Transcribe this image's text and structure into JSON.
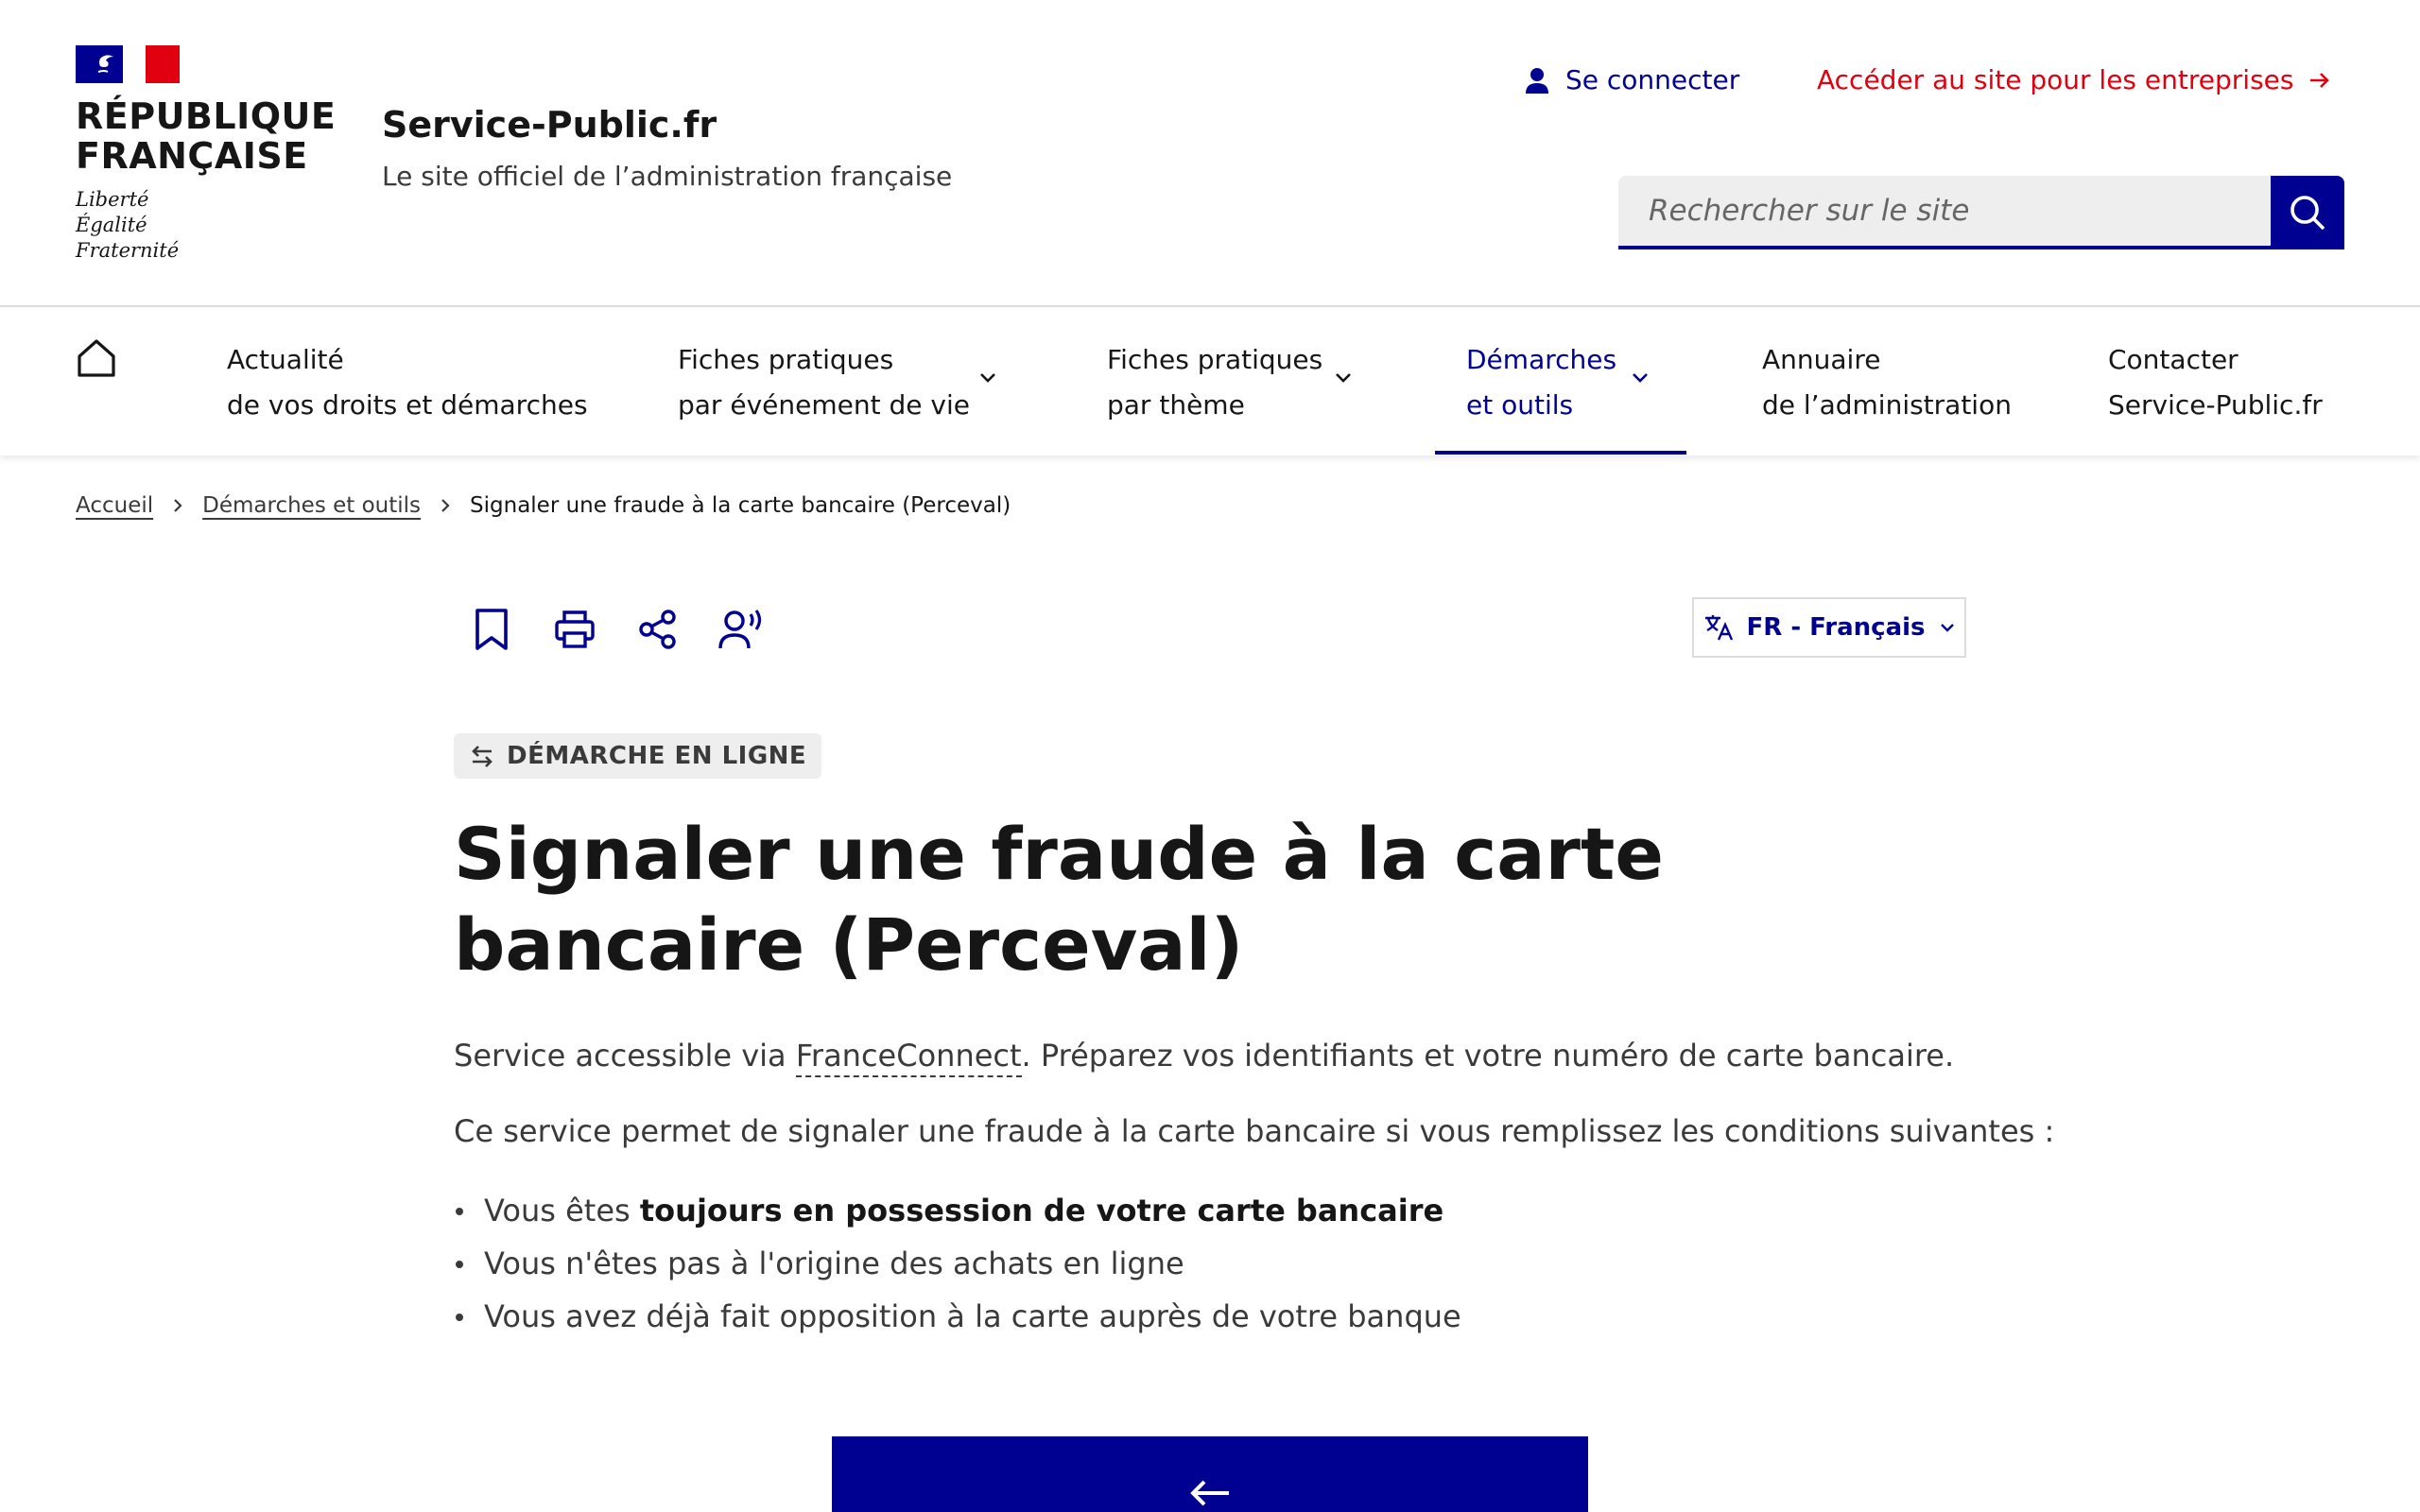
{
  "header": {
    "republic_title_line1": "RÉPUBLIQUE",
    "republic_title_line2": "FRANÇAISE",
    "motto_1": "Liberté",
    "motto_2": "Égalité",
    "motto_3": "Fraternité",
    "service_name": "Service-Public.fr",
    "service_tagline": "Le site officiel de l’administration française",
    "login_label": "Se connecter",
    "pro_link_label": "Accéder au site pour les entreprises",
    "search_placeholder": "Rechercher sur le site",
    "colors": {
      "primary": "#000091",
      "accent_red": "#e1000f"
    }
  },
  "nav": {
    "home_icon": "home-icon",
    "items": [
      {
        "line1": "Actualité",
        "line2": "de vos droits et démarches"
      },
      {
        "line1": "Fiches pratiques",
        "line2": "par événement de vie"
      },
      {
        "line1": "Fiches pratiques",
        "line2": "par thème"
      },
      {
        "line1": "Démarches",
        "line2": "et outils"
      },
      {
        "line1": "Annuaire",
        "line2": "de l’administration"
      },
      {
        "line1": "Contacter",
        "line2": "Service-Public.fr"
      }
    ],
    "active_index": 3
  },
  "breadcrumb": {
    "home": "Accueil",
    "section": "Démarches et outils",
    "current": "Signaler une fraude à la carte bancaire (Perceval)"
  },
  "tools": {
    "icons": [
      "bookmark-icon",
      "print-icon",
      "share-icon",
      "read-aloud-icon"
    ]
  },
  "language": {
    "label": "FR - Français"
  },
  "content": {
    "badge": "DÉMARCHE EN LIGNE",
    "title": "Signaler une fraude à la carte bancaire (Perceval)",
    "intro_before": "Service accessible via ",
    "intro_link": "FranceConnect",
    "intro_after": ". Préparez vos identifiants et votre numéro de carte bancaire.",
    "description": "Ce service permet de signaler une fraude à la carte bancaire si vous remplissez les conditions suivantes :",
    "condition_1_before": "Vous êtes ",
    "condition_1_bold": "toujours en possession de votre carte bancaire",
    "condition_2": "Vous n'êtes pas à l'origine des achats en ligne",
    "condition_3": "Vous avez déjà fait opposition à la carte auprès de votre banque"
  }
}
